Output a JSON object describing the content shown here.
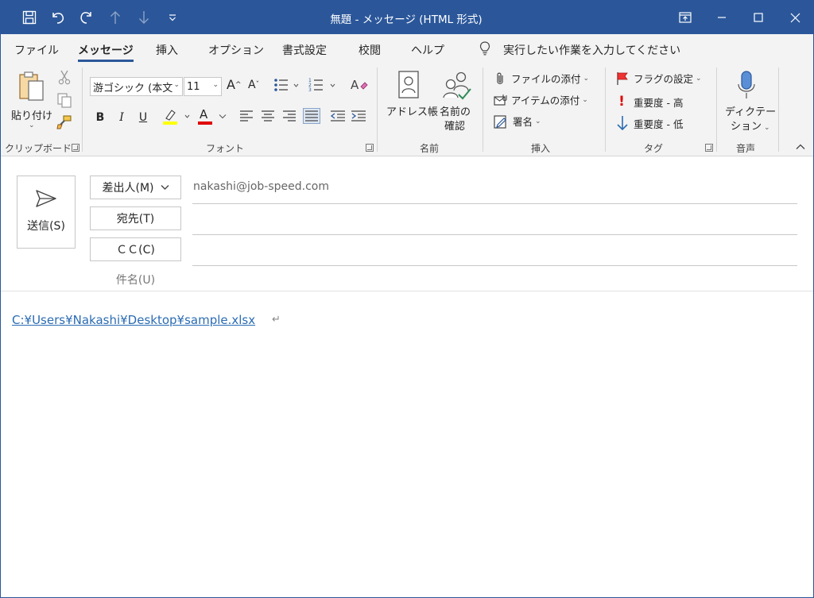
{
  "titlebar": {
    "title": "無題  -  メッセージ (HTML 形式)",
    "bg_color": "#2b579a"
  },
  "qat": [
    "save-icon",
    "undo-icon",
    "redo-icon",
    "up-arrow-icon",
    "down-arrow-icon",
    "customize-icon"
  ],
  "tabs": [
    {
      "label": "ファイル"
    },
    {
      "label": "メッセージ"
    },
    {
      "label": "挿入"
    },
    {
      "label": "オプション"
    },
    {
      "label": "書式設定"
    },
    {
      "label": "校閲"
    },
    {
      "label": "ヘルプ"
    }
  ],
  "tellme": "実行したい作業を入力してください",
  "ribbon": {
    "clipboard": {
      "paste": "貼り付け",
      "label": "クリップボード"
    },
    "font": {
      "family": "游ゴシック (本文",
      "size": "11",
      "bold": "B",
      "italic": "I",
      "underline": "U",
      "font_color": "A",
      "label": "フォント"
    },
    "names": {
      "address_book": "アドレス帳",
      "check_names_1": "名前の",
      "check_names_2": "確認",
      "label": "名前"
    },
    "insert": {
      "attach_file": "ファイルの添付",
      "attach_item": "アイテムの添付",
      "signature": "署名",
      "label": "挿入"
    },
    "tags": {
      "follow_up": "フラグの設定",
      "high": "重要度 - 高",
      "low": "重要度 - 低",
      "label": "タグ"
    },
    "voice": {
      "dictate_1": "ディクテー",
      "dictate_2": "ション",
      "label": "音声"
    }
  },
  "compose": {
    "send": "送信(S)",
    "from_button": "差出人(M)",
    "from_address": "nakashi@job-speed.com",
    "to_button": "宛先(T)",
    "to_value": "",
    "cc_button": "ＣＣ(C)",
    "cc_value": "",
    "subject_label": "件名(U)",
    "subject_value": ""
  },
  "body": {
    "link_text": "C:¥Users¥Nakashi¥Desktop¥sample.xlsx"
  }
}
